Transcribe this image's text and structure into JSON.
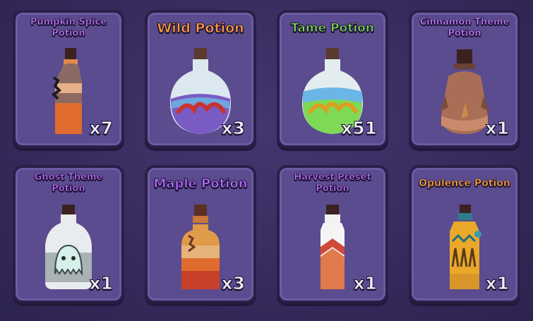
{
  "inventory": {
    "items": [
      {
        "name": "Pumpkin Spice Potion",
        "qty": "x7",
        "title_color": "#b874f0"
      },
      {
        "name": "Wild Potion",
        "qty": "x3",
        "title_color": "#ff9a3c"
      },
      {
        "name": "Tame Potion",
        "qty": "x51",
        "title_color": "#7ed957"
      },
      {
        "name": "Cinnamon Theme Potion",
        "qty": "x1",
        "title_color": "#c07cff"
      },
      {
        "name": "Ghost Theme Potion",
        "qty": "x1",
        "title_color": "#b56cf5"
      },
      {
        "name": "Maple Potion",
        "qty": "x3",
        "title_color": "#b06cff"
      },
      {
        "name": "Harvest Preset Potion",
        "qty": "x1",
        "title_color": "#b56cf5"
      },
      {
        "name": "Opulence Potion",
        "qty": "x1",
        "title_color": "#ffa63a"
      }
    ]
  }
}
